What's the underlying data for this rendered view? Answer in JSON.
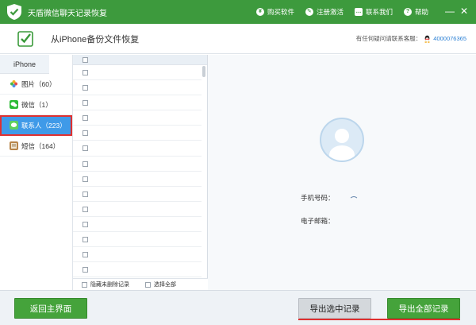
{
  "app": {
    "title": "天盾微信聊天记录恢复",
    "brand_color": "#3d9a3d",
    "logo_icon": "shield-check-icon"
  },
  "top_actions": [
    {
      "label": "购买软件",
      "icon": "cart-icon"
    },
    {
      "label": "注册激活",
      "icon": "key-icon"
    },
    {
      "label": "联系我们",
      "icon": "chat-icon"
    },
    {
      "label": "帮助",
      "icon": "help-icon"
    }
  ],
  "window_controls": {
    "minimize": "—",
    "close": "✕"
  },
  "header": {
    "title": "从iPhone备份文件恢复",
    "support_text": "有任何疑问请联系客服：",
    "support_qq": "4000076365"
  },
  "nav": {
    "heading": "iPhone",
    "items": [
      {
        "label": "图片（60）",
        "icon": "photos-icon",
        "active": false
      },
      {
        "label": "微信（1）",
        "icon": "wechat-icon",
        "active": false
      },
      {
        "label": "联系人（223）",
        "icon": "contacts-icon",
        "active": true
      },
      {
        "label": "短信（164）",
        "icon": "sms-icon",
        "active": false
      }
    ]
  },
  "list": {
    "row_count": 14,
    "footer": {
      "hide_deleted": "隐藏未删除记录",
      "select_all": "选择全部"
    }
  },
  "detail": {
    "phone_label": "手机号码：",
    "email_label": "电子邮箱："
  },
  "buttons": {
    "back": "返回主界面",
    "export_selected": "导出选中记录",
    "export_all": "导出全部记录"
  },
  "colors": {
    "accent_green": "#45a33b",
    "active_blue": "#3f9ae8",
    "highlight_red": "#e03030"
  }
}
